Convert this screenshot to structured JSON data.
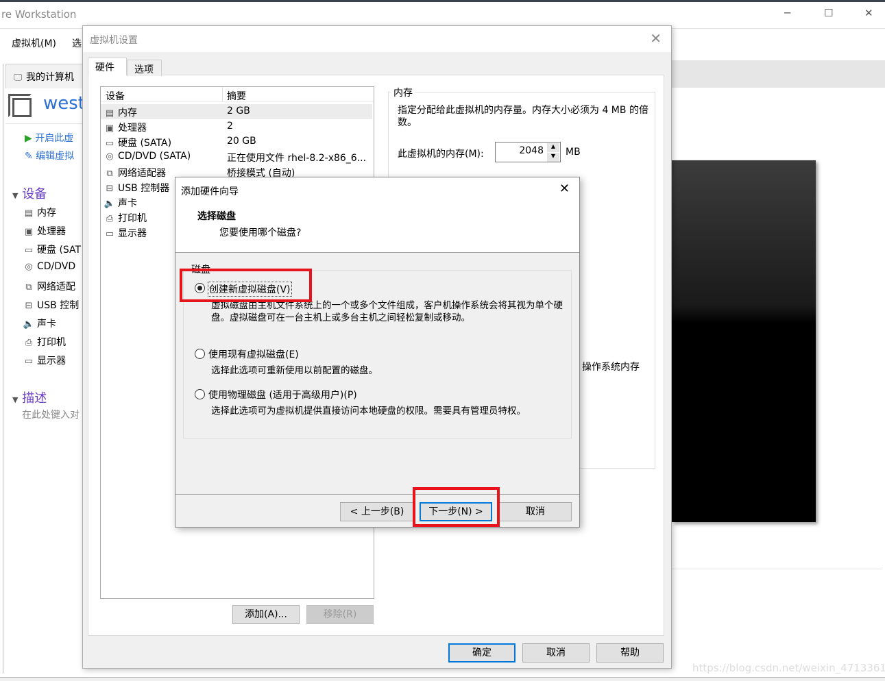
{
  "app": {
    "title": "re Workstation",
    "menu": [
      "虚拟机(M)",
      "选"
    ],
    "window_controls": [
      "minimize-icon",
      "maximize-icon",
      "close-icon"
    ]
  },
  "library": {
    "tab": "我的计算机",
    "vm_name": "west",
    "actions": [
      "开启此虚",
      "编辑虚拟"
    ],
    "devices_header": "设备",
    "devices": [
      "内存",
      "处理器",
      "硬盘 (SAT",
      "CD/DVD",
      "网络适配",
      "USB 控制",
      "声卡",
      "打印机",
      "显示器"
    ],
    "description_header": "描述",
    "description_placeholder": "在此处键入对"
  },
  "background": {
    "partial_text": "操作系统内存",
    "watermark": "https://blog.csdn.net/weixin_47133613"
  },
  "settings": {
    "title": "虚拟机设置",
    "tabs": [
      "硬件",
      "选项"
    ],
    "columns": [
      "设备",
      "摘要"
    ],
    "rows": [
      {
        "device": "内存",
        "summary": "2 GB",
        "icon": "memory-icon",
        "selected": true
      },
      {
        "device": "处理器",
        "summary": "2",
        "icon": "cpu-icon"
      },
      {
        "device": "硬盘 (SATA)",
        "summary": "20 GB",
        "icon": "hard-disk-icon"
      },
      {
        "device": "CD/DVD (SATA)",
        "summary": "正在使用文件 rhel-8.2-x86_6...",
        "icon": "cd-icon"
      },
      {
        "device": "网络适配器",
        "summary": "桥接模式 (自动)",
        "icon": "network-icon"
      },
      {
        "device": "USB 控制器",
        "summary": "",
        "icon": "usb-icon"
      },
      {
        "device": "声卡",
        "summary": "",
        "icon": "speaker-icon"
      },
      {
        "device": "打印机",
        "summary": "",
        "icon": "printer-icon"
      },
      {
        "device": "显示器",
        "summary": "",
        "icon": "monitor-icon"
      }
    ],
    "memory": {
      "group": "内存",
      "description": "指定分配给此虚拟机的内存量。内存大小必须为 4 MB 的倍数。",
      "label": "此虚拟机的内存(M):",
      "value": "2048",
      "unit": "MB"
    },
    "add": "添加(A)...",
    "remove": "移除(R)",
    "ok": "确定",
    "cancel": "取消",
    "help": "帮助"
  },
  "wizard": {
    "title": "添加硬件向导",
    "heading": "选择磁盘",
    "subheading": "您要使用哪个磁盘?",
    "group": "磁盘",
    "options": [
      {
        "label": "创建新虚拟磁盘(V)",
        "desc": "虚拟磁盘由主机文件系统上的一个或多个文件组成，客户机操作系统会将其视为单个硬盘。虚拟磁盘可在一台主机上或多台主机之间轻松复制或移动。",
        "selected": true
      },
      {
        "label": "使用现有虚拟磁盘(E)",
        "desc": "选择此选项可重新使用以前配置的磁盘。",
        "selected": false
      },
      {
        "label": "使用物理磁盘 (适用于高级用户)(P)",
        "desc": "选择此选项可为虚拟机提供直接访问本地硬盘的权限。需要具有管理员特权。",
        "selected": false
      }
    ],
    "back": "< 上一步(B)",
    "next": "下一步(N) >",
    "cancel": "取消"
  },
  "colors": {
    "highlight": "#e8141c",
    "link": "#2a6fd6",
    "section": "#6a3fc6",
    "focus": "#0078d7"
  }
}
